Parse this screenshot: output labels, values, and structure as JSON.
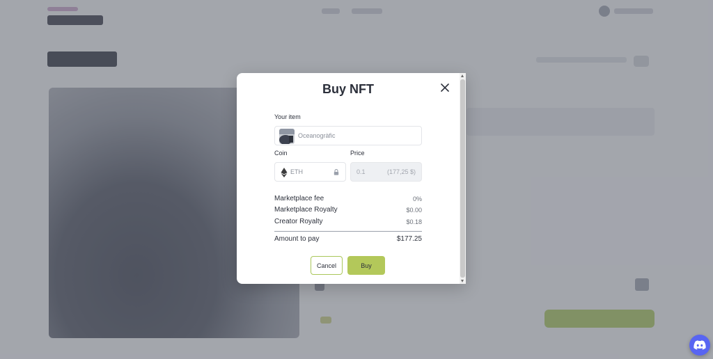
{
  "modal": {
    "title": "Buy NFT",
    "your_item_label": "Your item",
    "item_name": "Oceanogràfic",
    "coin_label": "Coin",
    "coin_value": "ETH",
    "price_label": "Price",
    "price_value": "0.1",
    "price_usd": "(177,25 $)",
    "fees": [
      {
        "label": "Marketplace fee",
        "value": "0%"
      },
      {
        "label": "Marketplace Royalty",
        "value": "$0.00"
      },
      {
        "label": "Creator Royalty",
        "value": "$0.18"
      }
    ],
    "total_label": "Amount to pay",
    "total_value": "$177.25",
    "cancel_label": "Cancel",
    "buy_label": "Buy"
  },
  "colors": {
    "accent": "#b3c85a",
    "accent_border": "#a9c75a",
    "overlay": "rgba(96,100,112,0.55)",
    "discord": "#5865f2"
  },
  "icons": [
    "close-icon",
    "eth-icon",
    "lock-icon",
    "discord-icon"
  ]
}
